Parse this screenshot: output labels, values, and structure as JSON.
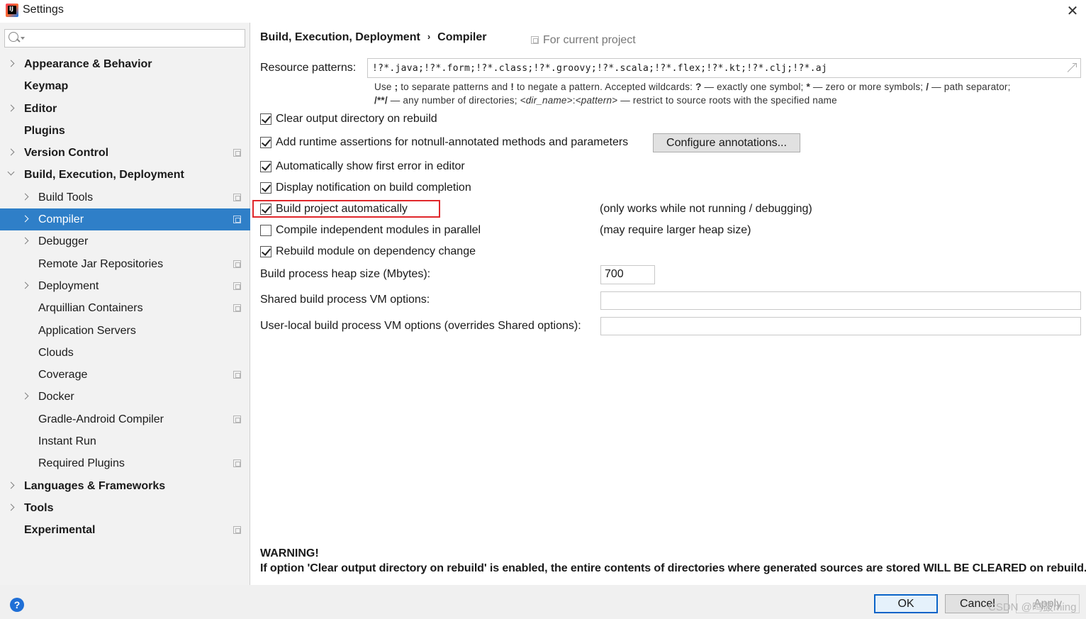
{
  "window": {
    "title": "Settings",
    "app_icon": "intellij-icon",
    "close_glyph": "✕"
  },
  "sidebar": {
    "search_placeholder": "",
    "items": [
      {
        "label": "Appearance & Behavior",
        "level": 0,
        "expandable": true,
        "expanded": false,
        "project_scoped": false,
        "selected": false
      },
      {
        "label": "Keymap",
        "level": 0,
        "expandable": false,
        "expanded": false,
        "project_scoped": false,
        "selected": false
      },
      {
        "label": "Editor",
        "level": 0,
        "expandable": true,
        "expanded": false,
        "project_scoped": false,
        "selected": false
      },
      {
        "label": "Plugins",
        "level": 0,
        "expandable": false,
        "expanded": false,
        "project_scoped": false,
        "selected": false
      },
      {
        "label": "Version Control",
        "level": 0,
        "expandable": true,
        "expanded": false,
        "project_scoped": true,
        "selected": false
      },
      {
        "label": "Build, Execution, Deployment",
        "level": 0,
        "expandable": true,
        "expanded": true,
        "project_scoped": false,
        "selected": false
      },
      {
        "label": "Build Tools",
        "level": 1,
        "expandable": true,
        "expanded": false,
        "project_scoped": true,
        "selected": false
      },
      {
        "label": "Compiler",
        "level": 1,
        "expandable": true,
        "expanded": false,
        "project_scoped": true,
        "selected": true
      },
      {
        "label": "Debugger",
        "level": 1,
        "expandable": true,
        "expanded": false,
        "project_scoped": false,
        "selected": false
      },
      {
        "label": "Remote Jar Repositories",
        "level": 1,
        "expandable": false,
        "expanded": false,
        "project_scoped": true,
        "selected": false
      },
      {
        "label": "Deployment",
        "level": 1,
        "expandable": true,
        "expanded": false,
        "project_scoped": true,
        "selected": false
      },
      {
        "label": "Arquillian Containers",
        "level": 1,
        "expandable": false,
        "expanded": false,
        "project_scoped": true,
        "selected": false
      },
      {
        "label": "Application Servers",
        "level": 1,
        "expandable": false,
        "expanded": false,
        "project_scoped": false,
        "selected": false
      },
      {
        "label": "Clouds",
        "level": 1,
        "expandable": false,
        "expanded": false,
        "project_scoped": false,
        "selected": false
      },
      {
        "label": "Coverage",
        "level": 1,
        "expandable": false,
        "expanded": false,
        "project_scoped": true,
        "selected": false
      },
      {
        "label": "Docker",
        "level": 1,
        "expandable": true,
        "expanded": false,
        "project_scoped": false,
        "selected": false
      },
      {
        "label": "Gradle-Android Compiler",
        "level": 1,
        "expandable": false,
        "expanded": false,
        "project_scoped": true,
        "selected": false
      },
      {
        "label": "Instant Run",
        "level": 1,
        "expandable": false,
        "expanded": false,
        "project_scoped": false,
        "selected": false
      },
      {
        "label": "Required Plugins",
        "level": 1,
        "expandable": false,
        "expanded": false,
        "project_scoped": true,
        "selected": false
      },
      {
        "label": "Languages & Frameworks",
        "level": 0,
        "expandable": true,
        "expanded": false,
        "project_scoped": false,
        "selected": false
      },
      {
        "label": "Tools",
        "level": 0,
        "expandable": true,
        "expanded": false,
        "project_scoped": false,
        "selected": false
      },
      {
        "label": "Experimental",
        "level": 0,
        "expandable": false,
        "expanded": false,
        "project_scoped": true,
        "selected": false
      }
    ]
  },
  "content": {
    "breadcrumb": [
      "Build, Execution, Deployment",
      "Compiler"
    ],
    "breadcrumb_sep": "›",
    "for_current_project": "For current project",
    "resource_patterns": {
      "label": "Resource patterns:",
      "value": "!?*.java;!?*.form;!?*.class;!?*.groovy;!?*.scala;!?*.flex;!?*.kt;!?*.clj;!?*.aj"
    },
    "hint_line1": {
      "p1": "Use ",
      "b1": ";",
      "p2": " to separate patterns and ",
      "b2": "!",
      "p3": " to negate a pattern. Accepted wildcards: ",
      "b3": "?",
      "p4": " — exactly one symbol; ",
      "b4": "*",
      "p5": " — zero or more symbols; ",
      "b5": "/",
      "p6": " — path separator;"
    },
    "hint_line2": {
      "b1": "/**/",
      "p1": " — any number of directories; ",
      "i1": "<dir_name>",
      "p2": ":",
      "i2": "<pattern>",
      "p3": " — restrict to source roots with the specified name"
    },
    "checkboxes": [
      {
        "label": "Clear output directory on rebuild",
        "checked": true
      },
      {
        "label": "Add runtime assertions for notnull-annotated methods and parameters",
        "checked": true
      },
      {
        "label": "Automatically show first error in editor",
        "checked": true
      },
      {
        "label": "Display notification on build completion",
        "checked": true
      },
      {
        "label": "Build project automatically",
        "checked": true
      },
      {
        "label": "Compile independent modules in parallel",
        "checked": false
      },
      {
        "label": "Rebuild module on dependency change",
        "checked": true
      }
    ],
    "configure_annotations_label": "Configure annotations...",
    "note_build_auto": "(only works while not running / debugging)",
    "note_parallel": "(may require larger heap size)",
    "heap_label": "Build process heap size (Mbytes):",
    "heap_value": "700",
    "shared_vm_label": "Shared build process VM options:",
    "shared_vm_value": "",
    "user_vm_label": "User-local build process VM options (overrides Shared options):",
    "user_vm_value": "",
    "warning_title": "WARNING!",
    "warning_body": "If option 'Clear output directory on rebuild' is enabled, the entire contents of directories where generated sources are stored WILL BE CLEARED on rebuild."
  },
  "footer": {
    "help_glyph": "?",
    "ok_label": "OK",
    "cancel_label": "Cancel",
    "apply_label": "Apply",
    "watermark": "CSDN @鸣鼓ming"
  },
  "colors": {
    "selection": "#2f7fc8",
    "highlight_border": "#e0272b",
    "help_icon": "#1f6fd6"
  }
}
